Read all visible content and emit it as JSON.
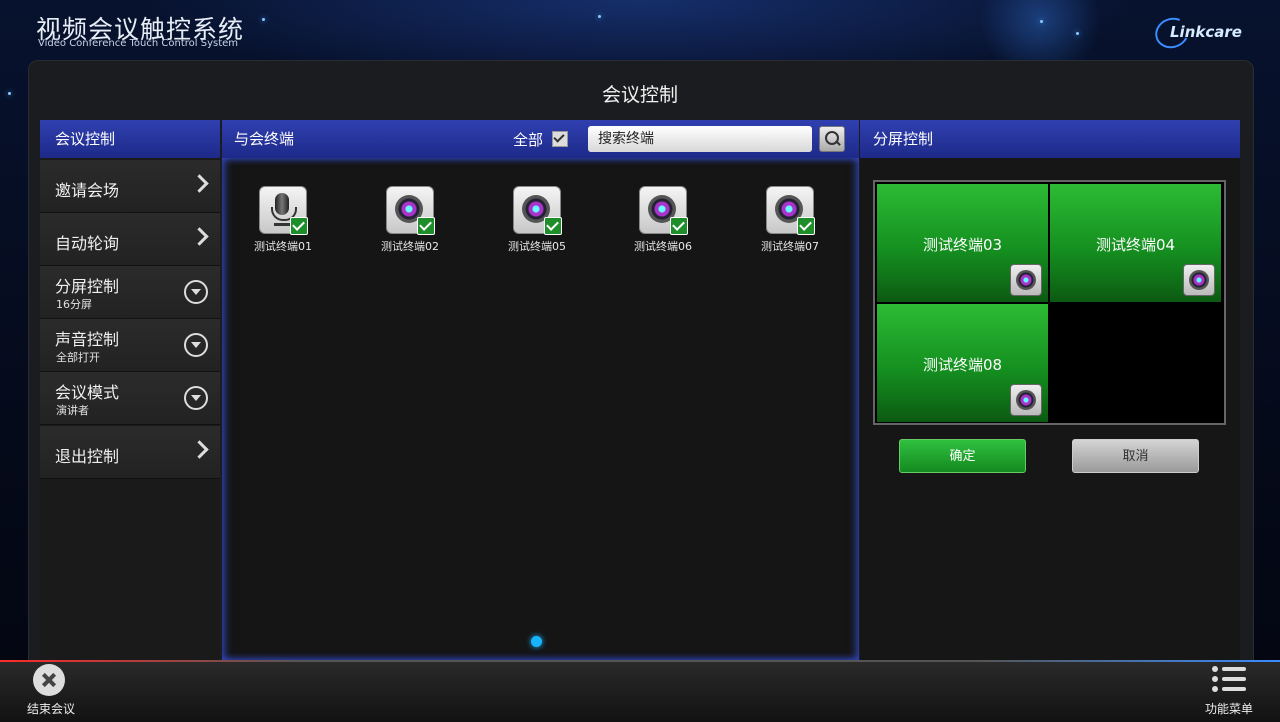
{
  "header": {
    "title": "视频会议触控系统",
    "subtitle": "Video Conference Touch Control System",
    "logo_text": "Linkcare"
  },
  "page_title": "会议控制",
  "left_panel": {
    "heading": "会议控制",
    "items": [
      {
        "label": "邀请会场",
        "sub": ""
      },
      {
        "label": "自动轮询",
        "sub": ""
      },
      {
        "label": "分屏控制",
        "sub": "16分屏"
      },
      {
        "label": "声音控制",
        "sub": "全部打开"
      },
      {
        "label": "会议模式",
        "sub": "演讲者"
      },
      {
        "label": "退出控制",
        "sub": ""
      }
    ]
  },
  "middle_panel": {
    "heading": "与会终端",
    "select_all_label": "全部",
    "search_placeholder": "搜索终端",
    "terminals": [
      {
        "name": "测试终端01",
        "icon": "microphone-icon",
        "checked": true
      },
      {
        "name": "测试终端02",
        "icon": "camera-icon",
        "checked": true
      },
      {
        "name": "测试终端05",
        "icon": "camera-icon",
        "checked": true
      },
      {
        "name": "测试终端06",
        "icon": "camera-icon",
        "checked": true
      },
      {
        "name": "测试终端07",
        "icon": "camera-icon",
        "checked": true
      }
    ]
  },
  "right_panel": {
    "heading": "分屏控制",
    "cells": [
      {
        "name": "测试终端03"
      },
      {
        "name": "测试终端04"
      },
      {
        "name": "测试终端08"
      },
      {
        "name": ""
      }
    ],
    "ok_label": "确定",
    "cancel_label": "取消"
  },
  "bottom_bar": {
    "end_label": "结束会议",
    "menu_label": "功能菜单"
  },
  "colors": {
    "panel_header": "#2434a0",
    "cell_green": "#1fa02a",
    "page_indicator": "#19b4ff"
  }
}
